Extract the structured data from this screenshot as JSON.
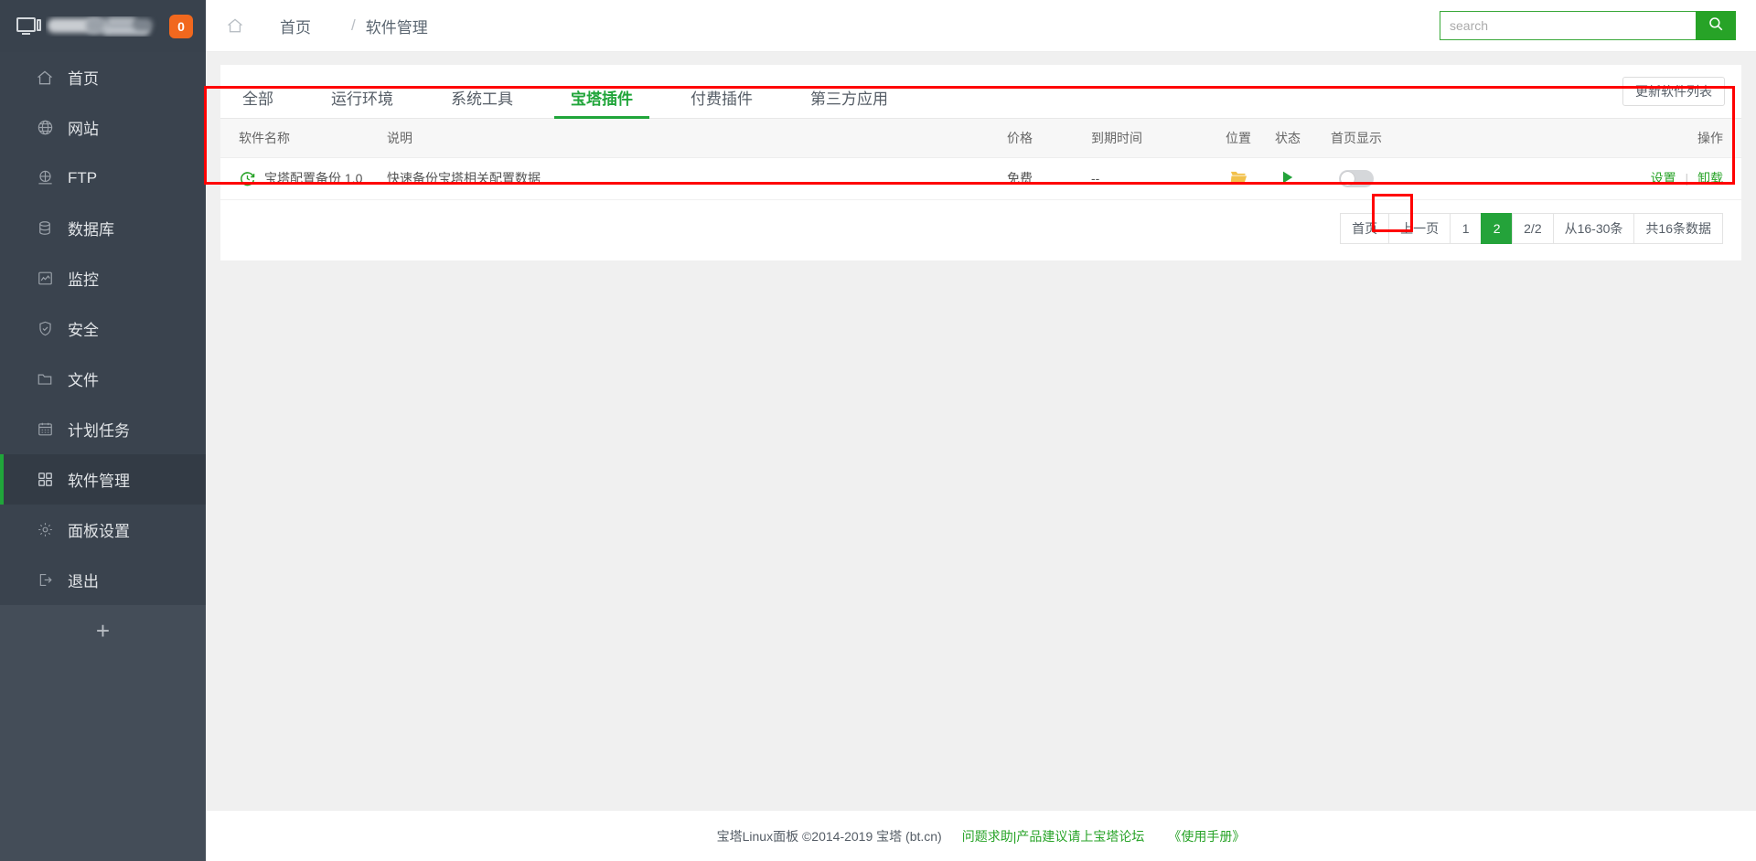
{
  "sidebar": {
    "badge": "0",
    "items": [
      {
        "label": "首页",
        "icon": "home-icon"
      },
      {
        "label": "网站",
        "icon": "globe-icon"
      },
      {
        "label": "FTP",
        "icon": "ftp-globe-icon"
      },
      {
        "label": "数据库",
        "icon": "database-icon"
      },
      {
        "label": "监控",
        "icon": "chart-monitor-icon"
      },
      {
        "label": "安全",
        "icon": "shield-check-icon"
      },
      {
        "label": "文件",
        "icon": "folder-icon"
      },
      {
        "label": "计划任务",
        "icon": "calendar-icon"
      },
      {
        "label": "软件管理",
        "icon": "grid-apps-icon"
      },
      {
        "label": "面板设置",
        "icon": "gear-icon"
      },
      {
        "label": "退出",
        "icon": "logout-icon"
      }
    ],
    "active_index": 8,
    "add_label": "+"
  },
  "topbar": {
    "breadcrumb_home": "首页",
    "breadcrumb_sep": "/",
    "breadcrumb_current": "软件管理",
    "search_placeholder": "search",
    "search_value": ""
  },
  "tabs": [
    {
      "label": "全部"
    },
    {
      "label": "运行环境"
    },
    {
      "label": "系统工具"
    },
    {
      "label": "宝塔插件"
    },
    {
      "label": "付费插件"
    },
    {
      "label": "第三方应用"
    }
  ],
  "tabs_active_index": 3,
  "update_button": "更新软件列表",
  "table": {
    "headers": [
      "软件名称",
      "说明",
      "价格",
      "到期时间",
      "位置",
      "状态",
      "首页显示",
      "操作"
    ],
    "rows": [
      {
        "name": "宝塔配置备份 1.0",
        "desc": "快速备份宝塔相关配置数据",
        "price": "免费",
        "expire": "--",
        "location_icon": "folder-open-icon",
        "state_icon": "play-icon",
        "homepage_toggle": "off",
        "op_settings": "设置",
        "op_sep": "|",
        "op_uninstall": "卸载"
      }
    ]
  },
  "pagination": {
    "first": "首页",
    "prev": "上一页",
    "page1": "1",
    "page2": "2",
    "active_page": "2",
    "ratio": "2/2",
    "range": "从16-30条",
    "total": "共16条数据"
  },
  "footer": {
    "copyright": "宝塔Linux面板 ©2014-2019 宝塔 (bt.cn)",
    "forum_link": "问题求助|产品建议请上宝塔论坛",
    "manual_link": "《使用手册》"
  },
  "colors": {
    "brand_green": "#20a53a",
    "badge_orange": "#f1681e",
    "sidebar_bg": "#3a434e",
    "annotation_red": "#ff0000",
    "folder_yellow": "#f2c14b"
  }
}
